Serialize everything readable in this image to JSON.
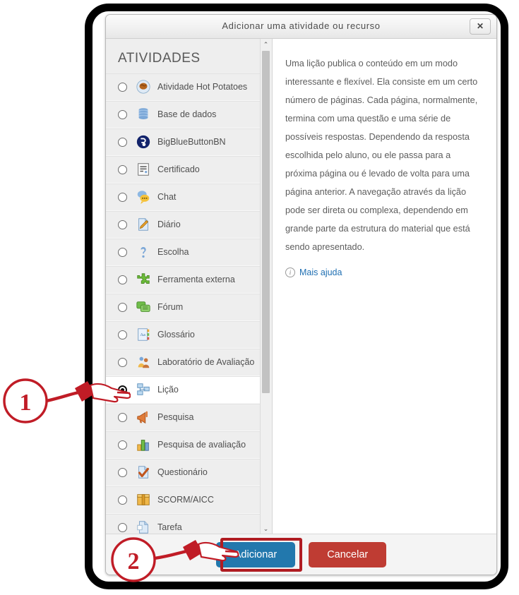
{
  "dialog": {
    "title": "Adicionar uma atividade ou recurso",
    "close_label": "✕",
    "close_icon": "close-icon"
  },
  "left_panel": {
    "section_title": "ATIVIDADES",
    "scroll_up_glyph": "⌃",
    "scroll_down_glyph": "⌄",
    "items": [
      {
        "label": "Atividade Hot Potatoes",
        "icon": "hot-potatoes-icon",
        "selected": false
      },
      {
        "label": "Base de dados",
        "icon": "database-icon",
        "selected": false
      },
      {
        "label": "BigBlueButtonBN",
        "icon": "bigbluebutton-icon",
        "selected": false
      },
      {
        "label": "Certificado",
        "icon": "certificate-icon",
        "selected": false
      },
      {
        "label": "Chat",
        "icon": "chat-icon",
        "selected": false
      },
      {
        "label": "Diário",
        "icon": "journal-icon",
        "selected": false
      },
      {
        "label": "Escolha",
        "icon": "choice-icon",
        "selected": false
      },
      {
        "label": "Ferramenta externa",
        "icon": "external-tool-icon",
        "selected": false
      },
      {
        "label": "Fórum",
        "icon": "forum-icon",
        "selected": false
      },
      {
        "label": "Glossário",
        "icon": "glossary-icon",
        "selected": false
      },
      {
        "label": "Laboratório de Avaliação",
        "icon": "workshop-icon",
        "selected": false
      },
      {
        "label": "Lição",
        "icon": "lesson-icon",
        "selected": true
      },
      {
        "label": "Pesquisa",
        "icon": "survey-megaphone-icon",
        "selected": false
      },
      {
        "label": "Pesquisa de avaliação",
        "icon": "feedback-chart-icon",
        "selected": false
      },
      {
        "label": "Questionário",
        "icon": "quiz-icon",
        "selected": false
      },
      {
        "label": "SCORM/AICC",
        "icon": "scorm-icon",
        "selected": false
      },
      {
        "label": "Tarefa",
        "icon": "assignment-icon",
        "selected": false
      }
    ]
  },
  "right_panel": {
    "description": "Uma lição publica o conteúdo em um modo interessante e flexível. Ela consiste em um certo número de páginas. Cada página, normalmente, termina com uma questão e uma série de possíveis respostas. Dependendo da resposta escolhida pelo aluno, ou ele passa para a próxima página ou é levado de volta para uma página anterior. A navegação através da lição pode ser direta ou complexa, dependendo em grande parte da estrutura do material que está sendo apresentado.",
    "more_help_label": "Mais ajuda",
    "more_help_icon": "info-circle-icon"
  },
  "footer": {
    "add_label": "Adicionar",
    "cancel_label": "Cancelar"
  },
  "annotations": {
    "step1": "1",
    "step2": "2"
  },
  "colors": {
    "add_button": "#2278ad",
    "cancel_button": "#bf3c33",
    "annotation_red": "#c01c26",
    "highlight_box": "#b01c22",
    "link_blue": "#1f6fb2",
    "panel_gray": "#eeeeee"
  }
}
